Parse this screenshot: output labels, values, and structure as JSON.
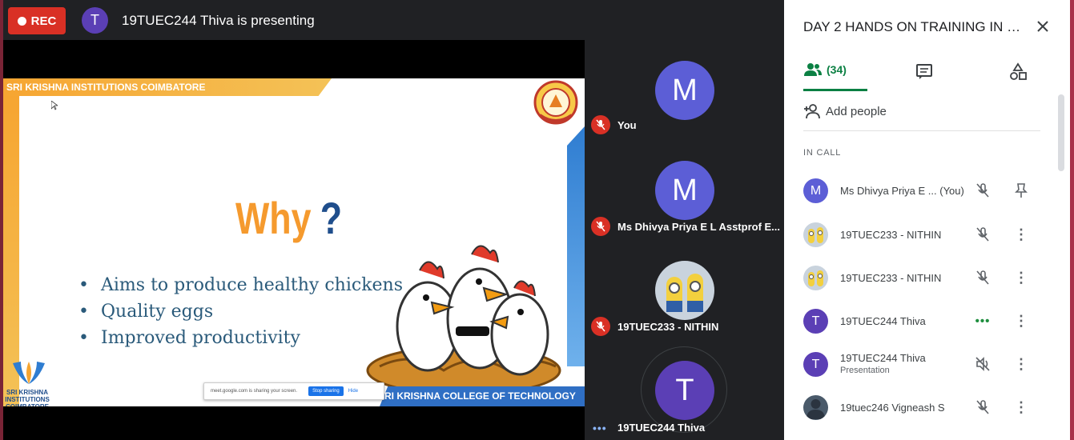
{
  "topbar": {
    "rec_label": "REC",
    "presenter_initial": "T",
    "presenter_text": "19TUEC244 Thiva is presenting"
  },
  "slide": {
    "header": "SRI KRISHNA INSTITUTIONS COIMBATORE",
    "title": "Why",
    "title_mark": "?",
    "bullet_symbol": "•",
    "bullets": [
      "Aims to produce healthy chickens",
      "Quality eggs",
      "Improved productivity"
    ],
    "footer": "RI KRISHNA COLLEGE OF TECHNOLOGY",
    "brand_text": "SRI KRISHNA INSTITUTIONS COIMBATORE",
    "share_text": "meet.google.com is sharing your screen.",
    "stop_sharing": "Stop sharing",
    "hide": "Hide"
  },
  "tiles": [
    {
      "initial": "M",
      "name": "You"
    },
    {
      "initial": "M",
      "name": "Ms Dhivya Priya E L Asstprof E..."
    },
    {
      "initial": "",
      "name": "19TUEC233 - NITHIN"
    },
    {
      "initial": "T",
      "name": "19TUEC244 Thiva"
    }
  ],
  "panel": {
    "title": "DAY 2 HANDS ON TRAINING IN E...",
    "people_count": "(34)",
    "add_people": "Add people",
    "in_call": "IN CALL",
    "participants": [
      {
        "initial": "M",
        "name": "Ms Dhivya Priya E ... (You)",
        "sub": "",
        "color": "#5c5ed6",
        "status": "muted",
        "action": "pin"
      },
      {
        "initial": "",
        "name": "19TUEC233 - NITHIN",
        "sub": "",
        "color": "#c8a94a",
        "status": "muted",
        "action": "more"
      },
      {
        "initial": "",
        "name": "19TUEC233 - NITHIN",
        "sub": "",
        "color": "#c8a94a",
        "status": "muted",
        "action": "more"
      },
      {
        "initial": "T",
        "name": "19TUEC244 Thiva",
        "sub": "",
        "color": "#5b3fb5",
        "status": "speaking",
        "action": "more"
      },
      {
        "initial": "T",
        "name": "19TUEC244 Thiva",
        "sub": "Presentation",
        "color": "#5b3fb5",
        "status": "sound-off",
        "action": "more"
      },
      {
        "initial": "",
        "name": "19tuec246 Vigneash S",
        "sub": "",
        "color": "#4a5a6a",
        "status": "muted",
        "action": "more"
      }
    ]
  },
  "colors": {
    "accent_green": "#0b8043",
    "rec_red": "#d93025",
    "avatar_blue": "#5c5ed6"
  }
}
